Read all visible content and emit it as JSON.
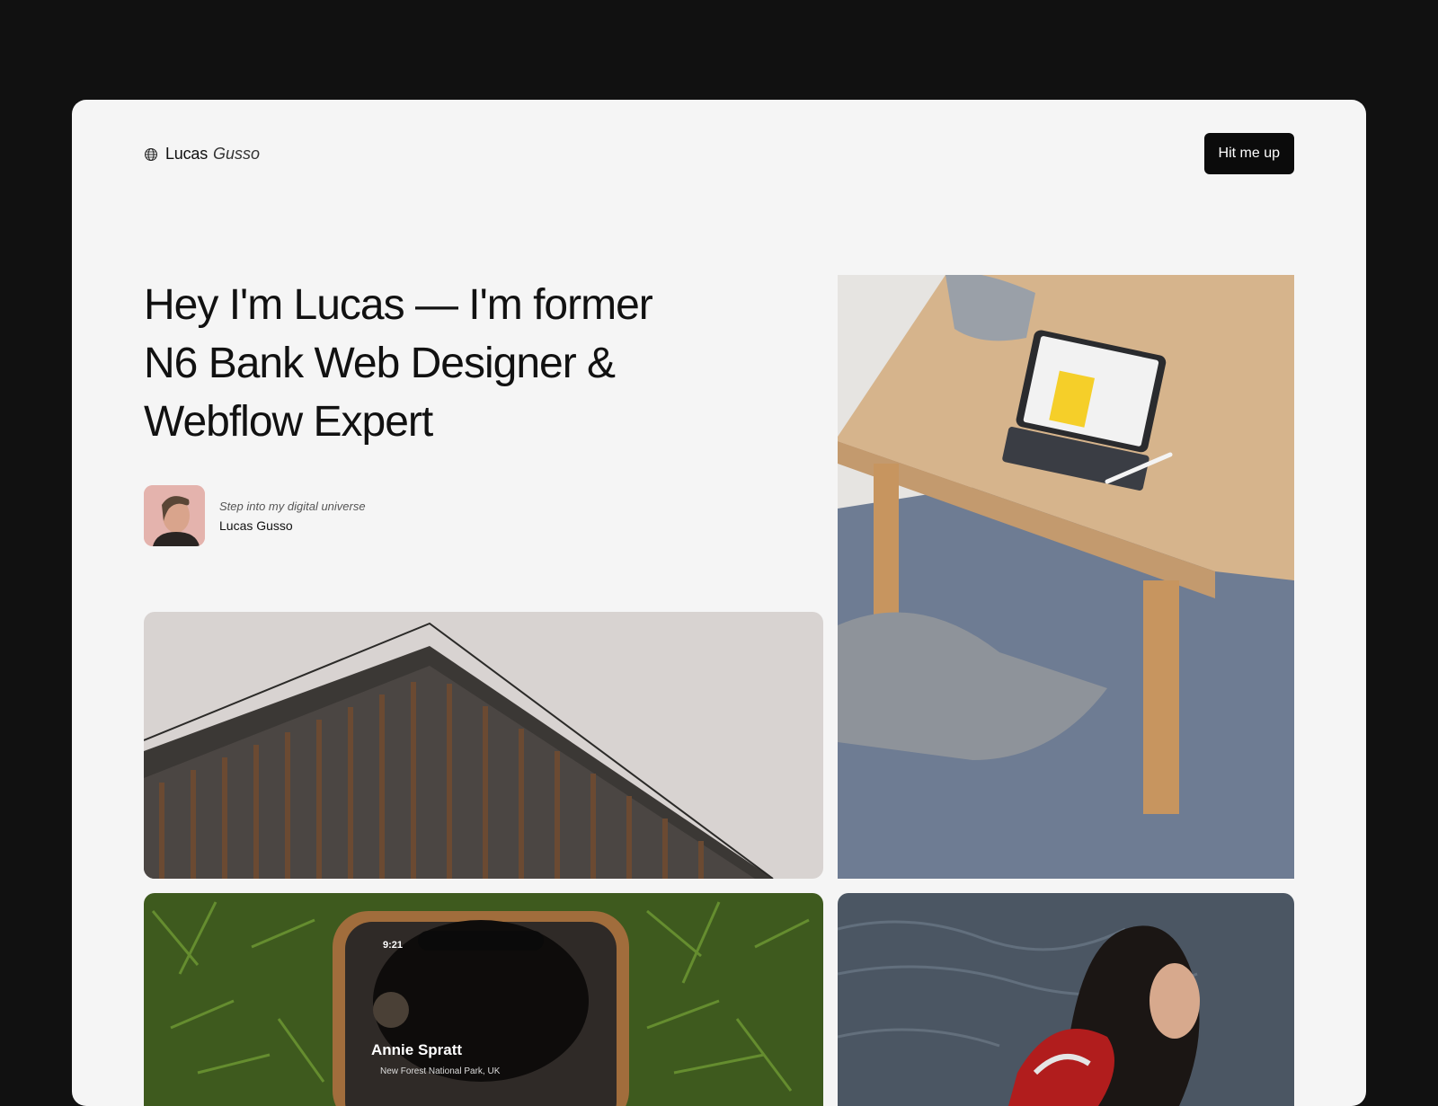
{
  "header": {
    "brand_first": "Lucas",
    "brand_last": "Gusso",
    "brand_icon": "globe-icon",
    "cta_label": "Hit me up"
  },
  "hero": {
    "title": "Hey I'm Lucas — I'm former N6 Bank Web Designer & Webflow Expert",
    "tagline": "Step into my digital universe",
    "author_name": "Lucas Gusso"
  },
  "gallery": {
    "phone_time": "9:21",
    "phone_profile_name": "Annie Spratt",
    "phone_profile_location": "New Forest National Park, UK"
  },
  "colors": {
    "backdrop": "#111111",
    "page": "#f5f5f5",
    "button": "#0b0b0b"
  }
}
